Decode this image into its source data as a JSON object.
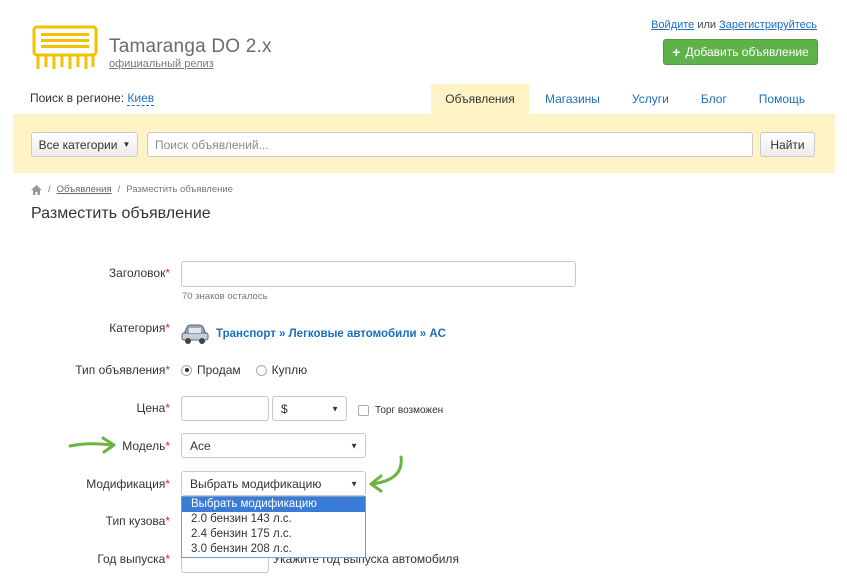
{
  "header": {
    "brand_title": "Tamaranga DO 2.x",
    "brand_subtitle": "официальный релиз",
    "login_label": "Войдите",
    "or_label": "или",
    "register_label": "Зарегистрируйтесь",
    "add_button_label": "Добавить объявление",
    "accent_color": "#5fb14a"
  },
  "region": {
    "label": "Поиск в регионе:",
    "value": "Киев"
  },
  "tabs": [
    {
      "label": "Объявления",
      "active": true
    },
    {
      "label": "Магазины",
      "active": false
    },
    {
      "label": "Услуги",
      "active": false
    },
    {
      "label": "Блог",
      "active": false
    },
    {
      "label": "Помощь",
      "active": false
    }
  ],
  "search": {
    "category_button": "Все категории",
    "placeholder": "Поиск объявлений...",
    "find_button": "Найти",
    "bar_color": "#fdf3c4"
  },
  "breadcrumb": {
    "home_icon": "home-icon",
    "items": [
      "Объявления",
      "Разместить объявление"
    ]
  },
  "page_title": "Разместить объявление",
  "form": {
    "title_label": "Заголовок",
    "title_value": "",
    "title_hint": "70 знаков осталось",
    "category_label": "Категория",
    "category_value": "Транспорт » Легковые автомобили » AC",
    "type_label": "Тип объявления",
    "type_options": [
      "Продам",
      "Куплю"
    ],
    "type_selected": "Продам",
    "price_label": "Цена",
    "price_value": "",
    "currency": "$",
    "bargain_label": "Торг возможен",
    "model_label": "Модель",
    "model_value": "Ace",
    "modification_label": "Модификация",
    "modification_value": "Выбрать модификацию",
    "modification_options": [
      "Выбрать модификацию",
      "2.0 бензин 143 л.с.",
      "2.4 бензин 175 л.с.",
      "3.0 бензин 208 л.с."
    ],
    "body_type_label": "Тип кузова",
    "year_label": "Год выпуска",
    "year_hint": "Укажите год выпуска автомобиля",
    "required_mark": "*"
  }
}
